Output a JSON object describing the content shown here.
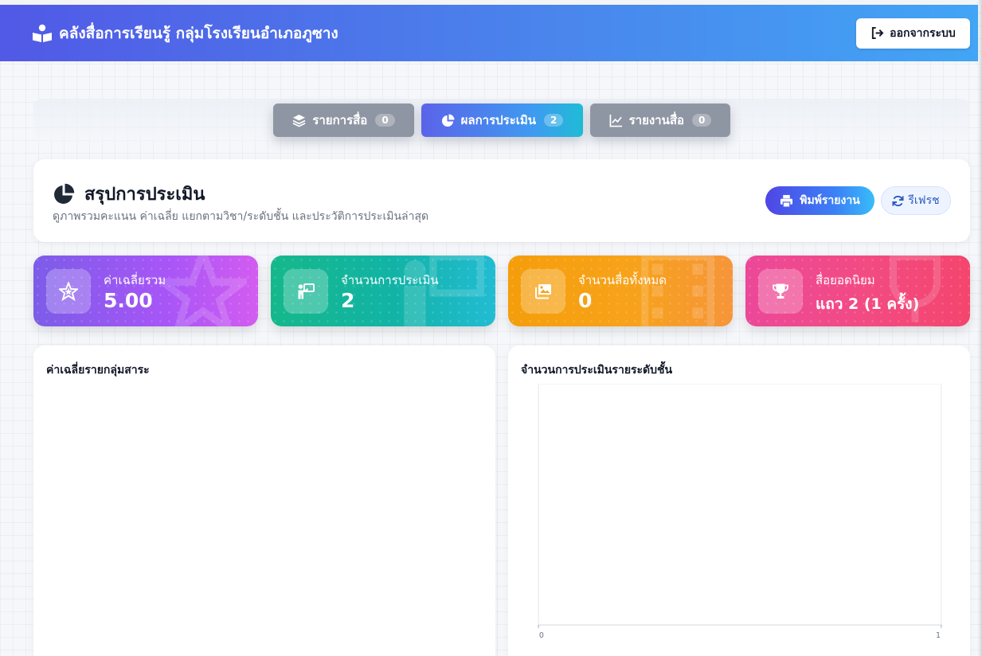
{
  "header": {
    "title": "คลังสื่อการเรียนรู้ กลุ่มโรงเรียนอำเภอภูซาง",
    "logout_label": "ออกจากระบบ"
  },
  "tabs": [
    {
      "label": "รายการสื่อ",
      "count": "0",
      "icon": "layers-icon",
      "active": false
    },
    {
      "label": "ผลการประเมิน",
      "count": "2",
      "icon": "pie-chart-icon",
      "active": true
    },
    {
      "label": "รายงานสื่อ",
      "count": "0",
      "icon": "line-chart-icon",
      "active": false
    }
  ],
  "summary": {
    "title": "สรุปการประเมิน",
    "subtitle": "ดูภาพรวมคะแนน ค่าเฉลี่ย แยกตามวิชา/ระดับชั้น และประวัติการประเมินล่าสุด",
    "print_label": "พิมพ์รายงาน",
    "refresh_label": "รีเฟรช"
  },
  "stats": [
    {
      "label": "ค่าเฉลี่ยรวม",
      "value": "5.00",
      "icon": "star-icon"
    },
    {
      "label": "จำนวนการประเมิน",
      "value": "2",
      "icon": "presenter-icon"
    },
    {
      "label": "จำนวนสื่อทั้งหมด",
      "value": "0",
      "icon": "images-icon"
    },
    {
      "label": "สื่อยอดนิยม",
      "value": "แถว 2 (1 ครั้ง)",
      "icon": "trophy-icon"
    }
  ],
  "panels": {
    "subject_avg_title": "ค่าเฉลี่ยรายกลุ่มสาระ",
    "grade_count_title": "จำนวนการประเมินรายระดับชั้น"
  },
  "chart_data": [
    {
      "type": "bar",
      "title": "ค่าเฉลี่ยรายกลุ่มสาระ",
      "categories": [],
      "values": []
    },
    {
      "type": "bar",
      "title": "จำนวนการประเมินรายระดับชั้น",
      "categories": [],
      "values": [],
      "xlim": [
        0,
        1
      ],
      "x_tick_labels": [
        "0",
        "1"
      ]
    }
  ],
  "colors": {
    "header_start": "#5159e6",
    "header_end": "#42a5f5",
    "tab_inactive": "#8f96a3",
    "stat_purple": "#a855f7",
    "stat_teal": "#12b3a6",
    "stat_orange": "#f7a21a",
    "stat_pink": "#f24b82"
  }
}
